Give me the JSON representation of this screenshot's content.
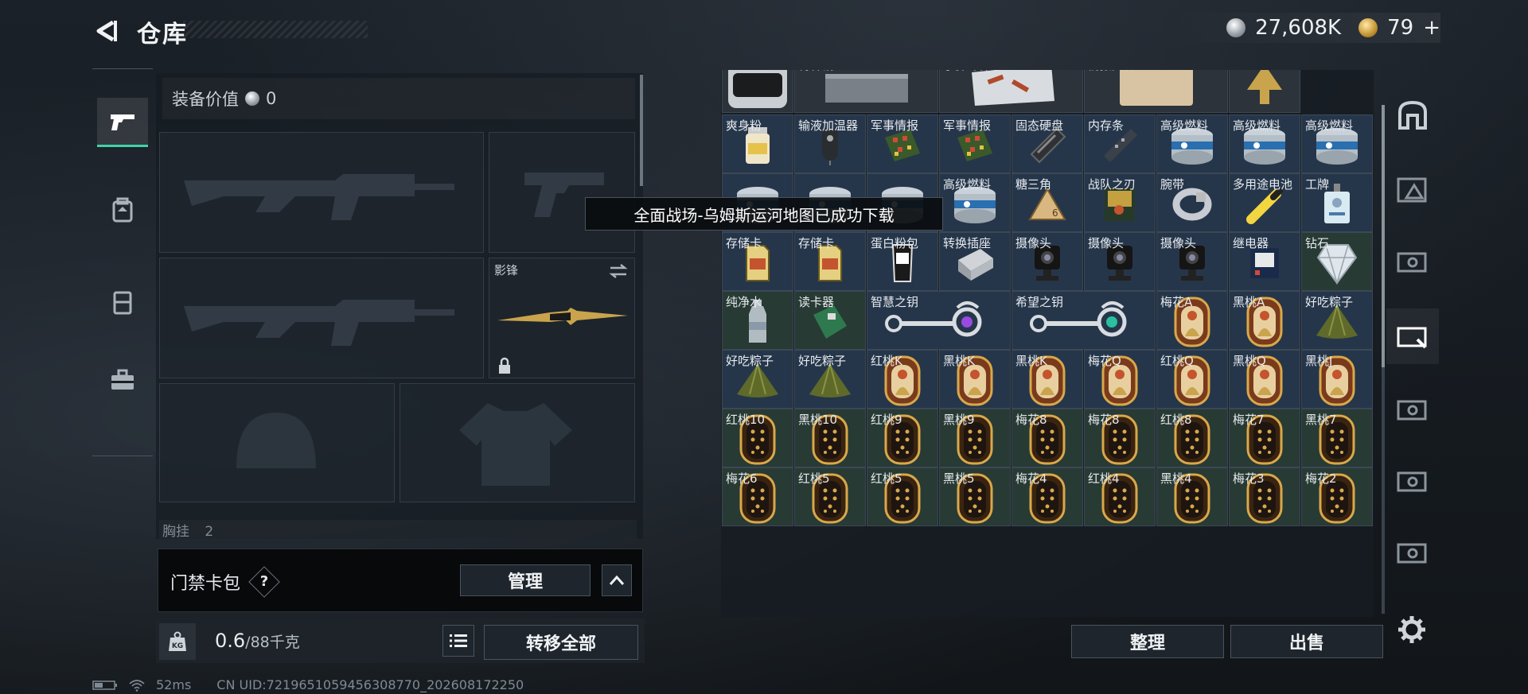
{
  "header": {
    "title": "仓库",
    "silver_amount": "27,608K",
    "gold_amount": "79",
    "gold_plus": "+"
  },
  "loadout": {
    "equip_value_label": "装备价值",
    "equip_value": "0",
    "melee_name": "影锋",
    "chest_label": "胸挂",
    "chest_value": "2"
  },
  "card_pack": {
    "label": "门禁卡包",
    "help": "?",
    "manage_label": "管理"
  },
  "weight": {
    "current": "0.6",
    "max": "/88千克",
    "transfer_all": "转移全部"
  },
  "status_bar": {
    "ping": "52ms",
    "uid": "CN UID:7219651059456308770_202608172250"
  },
  "toast": "全面战场-乌姆斯运河地图已成功下载",
  "inventory": {
    "rows": [
      [
        {
          "name": "",
          "icon": "device-icon",
          "bg": "gray"
        },
        {
          "name": "特种钢",
          "icon": "steel-icon",
          "bg": "gray"
        },
        {
          "name": "子弹零件包",
          "icon": "ammo-parts-icon",
          "bg": "gray"
        },
        {
          "name": "情报文件",
          "icon": "clipboard-icon",
          "bg": "gray"
        },
        {
          "name": "",
          "icon": "badge-icon",
          "bg": "gray"
        }
      ],
      [
        {
          "name": "爽身粉",
          "icon": "jar-icon",
          "bg": "blue"
        },
        {
          "name": "输液加温器",
          "icon": "warmer-icon",
          "bg": "blue"
        },
        {
          "name": "军事情报",
          "icon": "circuit-icon",
          "bg": "blue"
        },
        {
          "name": "军事情报",
          "icon": "circuit-icon",
          "bg": "blue"
        },
        {
          "name": "固态硬盘",
          "icon": "ssd-icon",
          "bg": "blue"
        },
        {
          "name": "内存条",
          "icon": "ram-icon",
          "bg": "blue"
        },
        {
          "name": "高级燃料",
          "icon": "fuel-can-icon",
          "bg": "blue"
        },
        {
          "name": "高级燃料",
          "icon": "fuel-can-icon",
          "bg": "blue"
        },
        {
          "name": "高级燃料",
          "icon": "fuel-can-icon",
          "bg": "blue"
        }
      ],
      [
        {
          "name": "",
          "icon": "fuel-can-icon",
          "bg": "blue"
        },
        {
          "name": "",
          "icon": "fuel-can-icon",
          "bg": "blue"
        },
        {
          "name": "",
          "icon": "fuel-can-icon",
          "bg": "blue"
        },
        {
          "name": "高级燃料",
          "icon": "fuel-can-icon",
          "bg": "blue"
        },
        {
          "name": "糖三角",
          "icon": "sugar-triangle-icon",
          "bg": "blue"
        },
        {
          "name": "战队之刃",
          "icon": "book-icon",
          "bg": "blue"
        },
        {
          "name": "腕带",
          "icon": "wristband-icon",
          "bg": "blue"
        },
        {
          "name": "多用途电池",
          "icon": "battery-icon",
          "bg": "blue"
        },
        {
          "name": "工牌",
          "icon": "id-badge-icon",
          "bg": "blue"
        }
      ],
      [
        {
          "name": "存储卡",
          "icon": "sd-card-icon",
          "bg": "blue"
        },
        {
          "name": "存储卡",
          "icon": "sd-card-icon",
          "bg": "blue"
        },
        {
          "name": "蛋白粉包",
          "icon": "protein-pack-icon",
          "bg": "blue"
        },
        {
          "name": "转换插座",
          "icon": "adapter-icon",
          "bg": "blue"
        },
        {
          "name": "摄像头",
          "icon": "camera-icon",
          "bg": "blue"
        },
        {
          "name": "摄像头",
          "icon": "camera-icon",
          "bg": "blue"
        },
        {
          "name": "摄像头",
          "icon": "camera-icon",
          "bg": "blue"
        },
        {
          "name": "继电器",
          "icon": "relay-icon",
          "bg": "blue"
        },
        {
          "name": "钻石",
          "icon": "diamond-icon",
          "bg": "green"
        }
      ],
      [
        {
          "name": "纯净水",
          "icon": "water-bottle-icon",
          "bg": "green"
        },
        {
          "name": "读卡器",
          "icon": "card-reader-icon",
          "bg": "green"
        },
        {
          "name": "智慧之钥",
          "icon": "purple-key-icon",
          "bg": "blue",
          "span": 2
        },
        {
          "name": "希望之钥",
          "icon": "teal-key-icon",
          "bg": "blue",
          "span": 2
        },
        {
          "name": "梅花A",
          "icon": "tarot-card-icon",
          "bg": "blue"
        },
        {
          "name": "黑桃A",
          "icon": "tarot-card-icon",
          "bg": "blue"
        },
        {
          "name": "好吃粽子",
          "icon": "zongzi-icon",
          "bg": "blue"
        }
      ],
      [
        {
          "name": "好吃粽子",
          "icon": "zongzi-icon",
          "bg": "blue"
        },
        {
          "name": "好吃粽子",
          "icon": "zongzi-icon",
          "bg": "blue"
        },
        {
          "name": "红桃K",
          "icon": "tarot-card-icon",
          "bg": "blue"
        },
        {
          "name": "黑桃K",
          "icon": "tarot-card-icon",
          "bg": "blue"
        },
        {
          "name": "黑桃K",
          "icon": "tarot-card-icon",
          "bg": "blue"
        },
        {
          "name": "梅花Q",
          "icon": "tarot-card-icon",
          "bg": "blue"
        },
        {
          "name": "红桃Q",
          "icon": "tarot-card-icon",
          "bg": "blue"
        },
        {
          "name": "黑桃Q",
          "icon": "tarot-card-icon",
          "bg": "blue"
        },
        {
          "name": "黑桃J",
          "icon": "tarot-card-icon",
          "bg": "blue"
        }
      ],
      [
        {
          "name": "红桃10",
          "icon": "dot-card-icon",
          "bg": "green"
        },
        {
          "name": "黑桃10",
          "icon": "dot-card-icon",
          "bg": "green"
        },
        {
          "name": "红桃9",
          "icon": "dot-card-icon",
          "bg": "green"
        },
        {
          "name": "黑桃9",
          "icon": "dot-card-icon",
          "bg": "green"
        },
        {
          "name": "梅花8",
          "icon": "dot-card-icon",
          "bg": "green"
        },
        {
          "name": "梅花8",
          "icon": "dot-card-icon",
          "bg": "green"
        },
        {
          "name": "红桃8",
          "icon": "dot-card-icon",
          "bg": "green"
        },
        {
          "name": "梅花7",
          "icon": "dot-card-icon",
          "bg": "green"
        },
        {
          "name": "黑桃7",
          "icon": "dot-card-icon",
          "bg": "green"
        }
      ],
      [
        {
          "name": "梅花6",
          "icon": "dot-card-icon",
          "bg": "green"
        },
        {
          "name": "红桃5",
          "icon": "dot-card-icon",
          "bg": "green"
        },
        {
          "name": "红桃5",
          "icon": "dot-card-icon",
          "bg": "green"
        },
        {
          "name": "黑桃5",
          "icon": "dot-card-icon",
          "bg": "green"
        },
        {
          "name": "梅花4",
          "icon": "dot-card-icon",
          "bg": "green"
        },
        {
          "name": "红桃4",
          "icon": "dot-card-icon",
          "bg": "green"
        },
        {
          "name": "黑桃4",
          "icon": "dot-card-icon",
          "bg": "green"
        },
        {
          "name": "梅花3",
          "icon": "dot-card-icon",
          "bg": "green"
        },
        {
          "name": "梅花2",
          "icon": "dot-card-icon",
          "bg": "green"
        }
      ]
    ]
  },
  "actions": {
    "sort": "整理",
    "sell": "出售"
  },
  "colors": {
    "accent_green": "#3fd3a8",
    "cell_blue": "#2a3542",
    "cell_green": "#283a34"
  }
}
